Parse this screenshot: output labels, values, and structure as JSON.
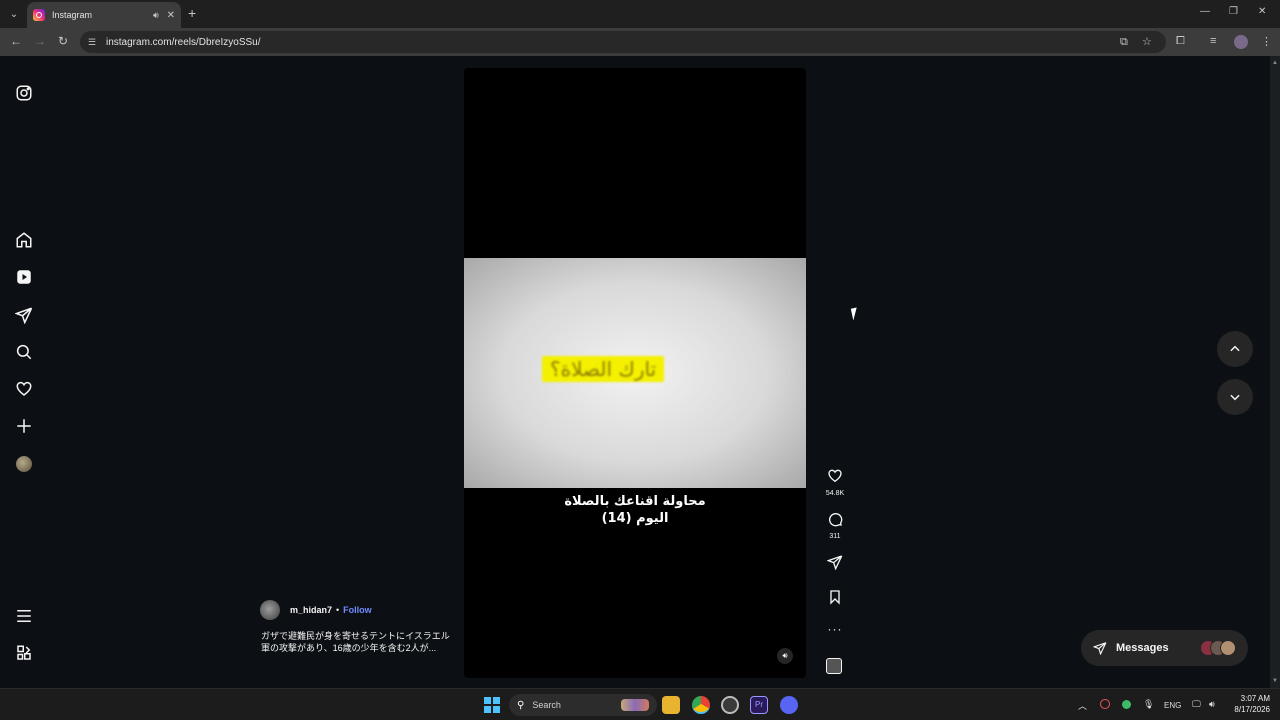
{
  "browser": {
    "tab_title": "Instagram",
    "url": "instagram.com/reels/DbreIzyoSSu/",
    "new_tab_symbol": "+"
  },
  "sidebar": {
    "items": [
      {
        "name": "instagram-logo-icon"
      },
      {
        "name": "home-icon"
      },
      {
        "name": "reels-icon"
      },
      {
        "name": "messages-icon"
      },
      {
        "name": "search-icon"
      },
      {
        "name": "notifications-heart-icon"
      },
      {
        "name": "create-plus-icon"
      },
      {
        "name": "profile-avatar"
      },
      {
        "name": "more-menu-icon"
      },
      {
        "name": "also-from-meta-icon"
      }
    ]
  },
  "reel": {
    "video_overlay_text": "تارك الصلاة؟",
    "caption_line1": "محاولة اقناعك بالصلاة",
    "caption_line2": "اليوم (14)",
    "author": "m_hidan7",
    "separator": "•",
    "follow_label": "Follow",
    "description": "ガザで避難民が身を寄せるテントにイスラエル軍の攻撃があり、16歳の少年を含む2人が...",
    "likes": "54.8K",
    "comments": "311"
  },
  "messages": {
    "label": "Messages"
  },
  "taskbar": {
    "search_label": "Search",
    "language": "ENG",
    "time": "3:07 AM",
    "date": "8/17/2026"
  },
  "colors": {
    "page_bg": "#0c1014",
    "follow_link": "#6f8cff",
    "highlight_yellow": "#f4f000"
  }
}
